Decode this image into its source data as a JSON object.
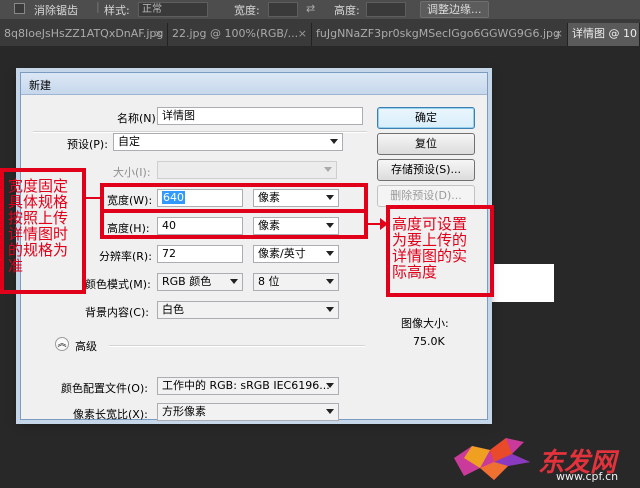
{
  "options_bar": {
    "anti_alias_label": "消除锯齿",
    "style_label": "样式:",
    "style_value": "正常",
    "width_label": "宽度:",
    "height_label": "高度:",
    "refine_edge_button": "调整边缘..."
  },
  "tabs": [
    {
      "label": "8q8IoeJsHsZZ1ATQxDnAF.jpg"
    },
    {
      "label": "22.jpg @ 100%(RGB/..."
    },
    {
      "label": "fuJgNNaZF3pr0skgMSecIGgo6GGWG9G6.jpg"
    },
    {
      "label": "详情图 @ 10"
    }
  ],
  "dialog": {
    "title": "新建",
    "name_label": "名称(N):",
    "name_value": "详情图",
    "preset_label": "预设(P):",
    "preset_value": "自定",
    "size_label": "大小(I):",
    "width_label": "宽度(W):",
    "width_value": "640",
    "width_unit": "像素",
    "height_label": "高度(H):",
    "height_value": "40",
    "height_unit": "像素",
    "resolution_label": "分辨率(R):",
    "resolution_value": "72",
    "resolution_unit": "像素/英寸",
    "color_mode_label": "颜色模式(M):",
    "color_mode_value": "RGB 颜色",
    "bit_depth_value": "8 位",
    "background_label": "背景内容(C):",
    "background_value": "白色",
    "advanced_label": "高级",
    "color_profile_label": "颜色配置文件(O):",
    "color_profile_value": "工作中的 RGB: sRGB IEC6196...",
    "pixel_aspect_label": "像素长宽比(X):",
    "pixel_aspect_value": "方形像素",
    "ok_button": "确定",
    "reset_button": "复位",
    "save_preset_button": "存储预设(S)...",
    "delete_preset_button": "删除预设(D)...",
    "image_size_label": "图像大小:",
    "image_size_value": "75.0K"
  },
  "annotations": {
    "left_lines": [
      "宽度固定",
      "具体规格",
      "按照上传",
      "详情图时",
      "的规格为",
      "准"
    ],
    "right_lines": [
      "高度可设置",
      "为要上传的",
      "详情图的实",
      "际高度"
    ],
    "color": "#e0001a"
  },
  "watermark": {
    "brand_text": "东发网",
    "url": "www.cpf.cn"
  }
}
